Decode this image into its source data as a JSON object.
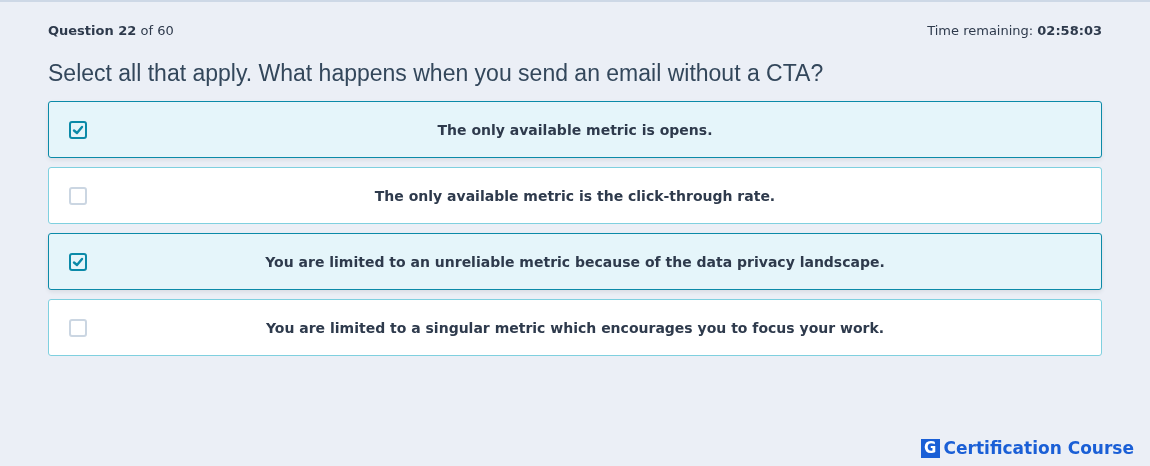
{
  "header": {
    "progress": "**Question 22** of 60",
    "timer": "Time remaining: **02:58:03**"
  },
  "question": "Select all that apply. What happens when you send an email without a CTA?",
  "options": [
    {
      "label": "The only available metric is opens.",
      "checked": true
    },
    {
      "label": "The only available metric is the click-through rate.",
      "checked": false
    },
    {
      "label": "You are limited to an unreliable metric because of the data privacy landscape.",
      "checked": true
    },
    {
      "label": "You are limited to a singular metric which encourages you to focus your work.",
      "checked": false
    }
  ],
  "brand": {
    "mark": "G",
    "name": "Certification Course"
  }
}
